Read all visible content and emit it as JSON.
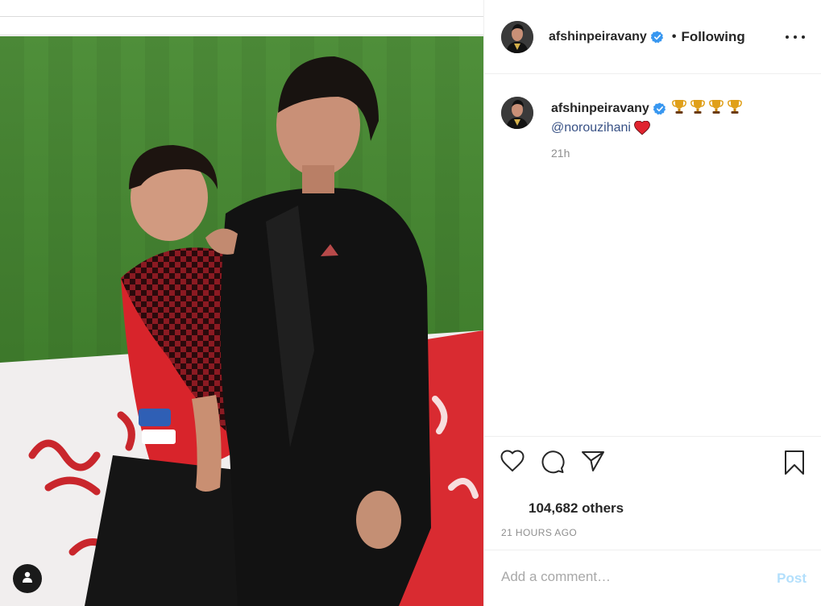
{
  "post": {
    "username": "afshinpeiravany",
    "follow_status": "Following",
    "separator": "•",
    "caption_mention": "@norouzihani",
    "caption_time": "21h",
    "likes_text": "104,682 others",
    "timestamp": "21 HOURS AGO",
    "comment_placeholder": "Add a comment…",
    "post_label": "Post"
  },
  "icons": {
    "verified": "verified-badge-icon",
    "trophy": "trophy-icon",
    "heart_emoji": "red-heart-icon",
    "like": "heart-outline-icon",
    "comment": "comment-icon",
    "share": "paper-plane-icon",
    "save": "bookmark-icon",
    "more": "more-options-icon",
    "tag": "user-tag-icon"
  },
  "colors": {
    "verified": "#3897f0",
    "link": "#385185",
    "post_disabled": "#b2dffc",
    "muted": "#8e8e8e"
  }
}
